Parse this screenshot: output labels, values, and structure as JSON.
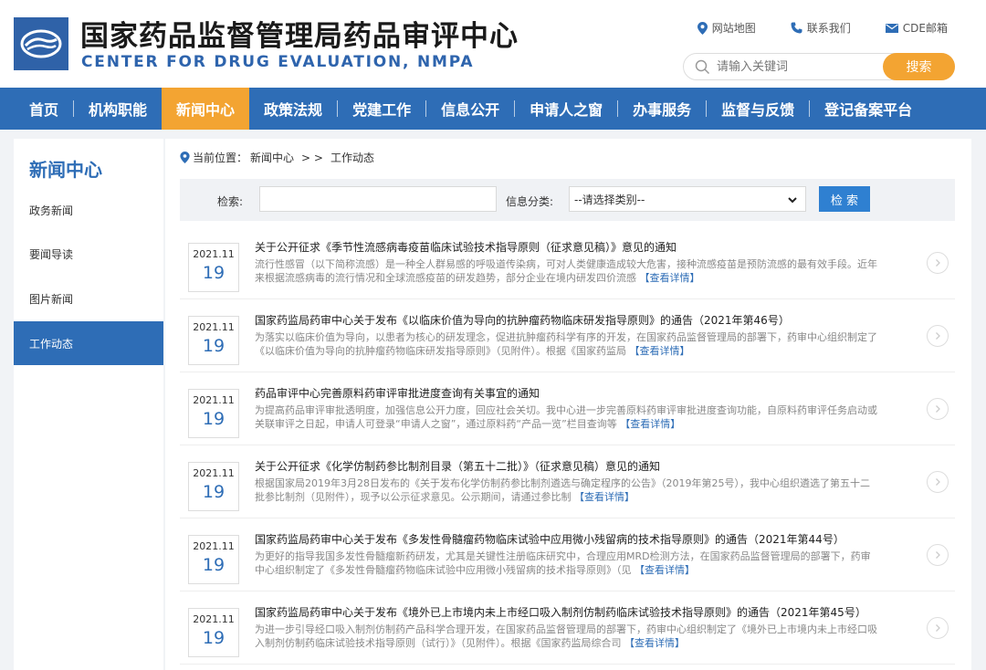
{
  "header": {
    "title": "国家药品监督管理局药品审评中心",
    "subtitle": "CENTER FOR DRUG EVALUATION, NMPA",
    "top_links": [
      {
        "label": "网站地图",
        "icon": "location-pin-icon"
      },
      {
        "label": "联系我们",
        "icon": "phone-icon"
      },
      {
        "label": "CDE邮箱",
        "icon": "mail-icon"
      }
    ],
    "search_placeholder": "请输入关键词",
    "search_button": "搜索"
  },
  "colors": {
    "primary": "#2e6db6",
    "accent": "#f3a432",
    "button_blue": "#2f80d1"
  },
  "nav": {
    "items": [
      "首页",
      "机构职能",
      "新闻中心",
      "政策法规",
      "党建工作",
      "信息公开",
      "申请人之窗",
      "办事服务",
      "监督与反馈",
      "登记备案平台"
    ],
    "active": "新闻中心"
  },
  "sidebar": {
    "title": "新闻中心",
    "items": [
      "政务新闻",
      "要闻导读",
      "图片新闻",
      "工作动态"
    ],
    "active": "工作动态"
  },
  "breadcrumb": {
    "prefix": "当前位置：",
    "path": "新闻中心",
    "sep": "> >",
    "current": "工作动态"
  },
  "filter": {
    "search_label": "检索:",
    "category_label": "信息分类:",
    "category_selected": "--请选择类别--",
    "button": "检 索"
  },
  "articles": [
    {
      "ym": "2021.11",
      "day": "19",
      "title": "关于公开征求《季节性流感病毒疫苗临床试验技术指导原则（征求意见稿）》意见的通知",
      "desc": "流行性感冒（以下简称流感）是一种全人群易感的呼吸道传染病，可对人类健康造成较大危害，接种流感疫苗是预防流感的最有效手段。近年来根据流感病毒的流行情况和全球流感疫苗的研发趋势，部分企业在境内研发四价流感",
      "more": "【查看详情】"
    },
    {
      "ym": "2021.11",
      "day": "19",
      "title": "国家药监局药审中心关于发布《以临床价值为导向的抗肿瘤药物临床研发指导原则》的通告（2021年第46号）",
      "desc": "为落实以临床价值为导向，以患者为核心的研发理念，促进抗肿瘤药科学有序的开发，在国家药品监督管理局的部署下，药审中心组织制定了《以临床价值为导向的抗肿瘤药物临床研发指导原则》（见附件）。根据《国家药监局",
      "more": "【查看详情】"
    },
    {
      "ym": "2021.11",
      "day": "19",
      "title": "药品审评中心完善原料药审评审批进度查询有关事宜的通知",
      "desc": "为提高药品审评审批透明度，加强信息公开力度，回应社会关切。我中心进一步完善原料药审评审批进度查询功能，自原料药审评任务启动或关联审评之日起，申请人可登录“申请人之窗”，通过原料药“产品一览”栏目查询等",
      "more": "【查看详情】"
    },
    {
      "ym": "2021.11",
      "day": "19",
      "title": "关于公开征求《化学仿制药参比制剂目录（第五十二批）》（征求意见稿）意见的通知",
      "desc": "根据国家局2019年3月28日发布的《关于发布化学仿制药参比制剂遴选与确定程序的公告》（2019年第25号），我中心组织遴选了第五十二批参比制剂（见附件），现予以公示征求意见。公示期间，请通过参比制",
      "more": "【查看详情】"
    },
    {
      "ym": "2021.11",
      "day": "19",
      "title": "国家药监局药审中心关于发布《多发性骨髓瘤药物临床试验中应用微小残留病的技术指导原则》的通告（2021年第44号）",
      "desc": "为更好的指导我国多发性骨髓瘤新药研发，尤其是关键性注册临床研究中，合理应用MRD检测方法，在国家药品监督管理局的部署下，药审中心组织制定了《多发性骨髓瘤药物临床试验中应用微小残留病的技术指导原则》（见",
      "more": "【查看详情】"
    },
    {
      "ym": "2021.11",
      "day": "19",
      "title": "国家药监局药审中心关于发布《境外已上市境内未上市经口吸入制剂仿制药临床试验技术指导原则》的通告（2021年第45号）",
      "desc": "为进一步引导经口吸入制剂仿制药产品科学合理开发，在国家药品监督管理局的部署下，药审中心组织制定了《境外已上市境内未上市经口吸入制剂仿制药临床试验技术指导原则（试行）》（见附件）。根据《国家药监局综合司",
      "more": "【查看详情】"
    }
  ]
}
